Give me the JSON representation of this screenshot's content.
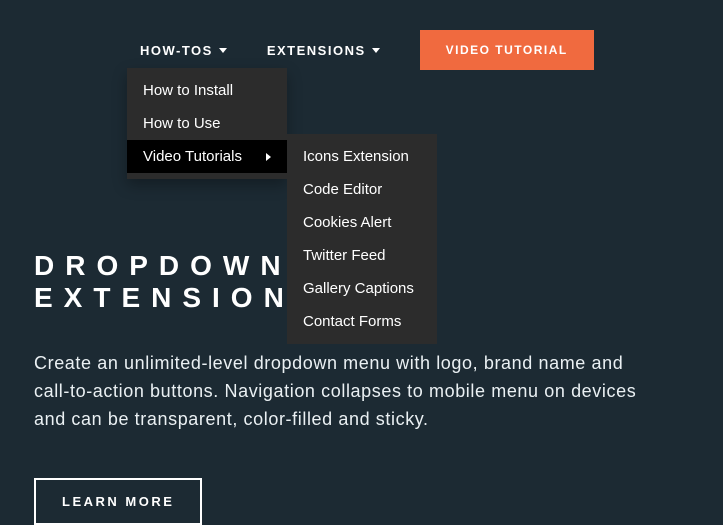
{
  "nav": {
    "howtos": {
      "label": "HOW-TOS"
    },
    "extensions": {
      "label": "EXTENSIONS"
    },
    "cta": {
      "label": "VIDEO TUTORIAL"
    }
  },
  "dropdown": {
    "items": [
      {
        "label": "How to Install"
      },
      {
        "label": "How to Use"
      },
      {
        "label": "Video Tutorials"
      }
    ]
  },
  "subdropdown": {
    "items": [
      {
        "label": "Icons Extension"
      },
      {
        "label": "Code Editor"
      },
      {
        "label": "Cookies Alert"
      },
      {
        "label": "Twitter Feed"
      },
      {
        "label": "Gallery Captions"
      },
      {
        "label": "Contact Forms"
      }
    ]
  },
  "hero": {
    "title": "DROPDOWN MENU EXTENSION",
    "description": "Create an unlimited-level dropdown menu with logo, brand name and call-to-action buttons. Navigation collapses to mobile menu on devices and can be transparent, color-filled and sticky.",
    "learn_more": "LEARN MORE"
  }
}
